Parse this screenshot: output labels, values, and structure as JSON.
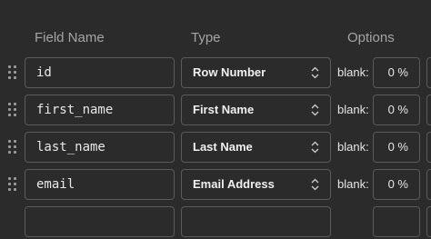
{
  "header": {
    "field_name": "Field Name",
    "type": "Type",
    "options": "Options"
  },
  "rows": [
    {
      "name": "id",
      "type": "Row Number",
      "blank_label": "blank:",
      "blank_value": "0 %"
    },
    {
      "name": "first_name",
      "type": "First Name",
      "blank_label": "blank:",
      "blank_value": "0 %"
    },
    {
      "name": "last_name",
      "type": "Last Name",
      "blank_label": "blank:",
      "blank_value": "0 %"
    },
    {
      "name": "email",
      "type": "Email Address",
      "blank_label": "blank:",
      "blank_value": "0 %"
    }
  ],
  "icons": {
    "drag": "drag-handle-icon",
    "select": "updown-chevron-icon"
  },
  "colors": {
    "background": "#2b2b2b",
    "border": "#5a5a5a",
    "header_text": "#a4a4a4"
  }
}
